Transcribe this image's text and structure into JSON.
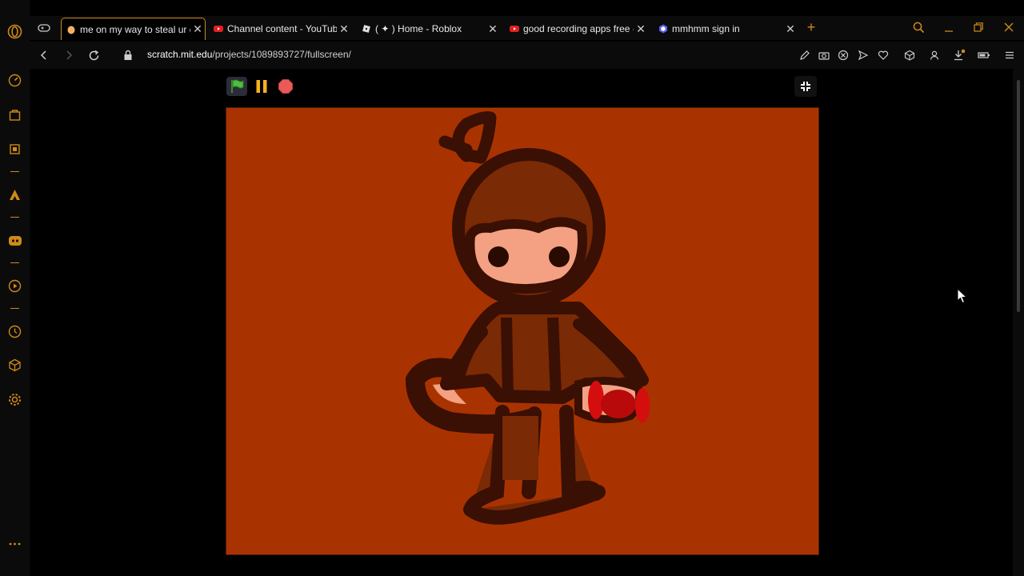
{
  "browser": {
    "tabs": [
      {
        "title": "me on my way to steal ur c",
        "active": true,
        "favicon": "scratch-cat-icon"
      },
      {
        "title": "Channel content - YouTube",
        "active": false,
        "favicon": "youtube-icon"
      },
      {
        "title": "( ✦ ) Home - Roblox",
        "active": false,
        "favicon": "roblox-icon"
      },
      {
        "title": "good recording apps free -",
        "active": false,
        "favicon": "youtube-icon"
      },
      {
        "title": "mmhmm sign in",
        "active": false,
        "favicon": "mmhmm-icon"
      }
    ],
    "new_tab_label": "+",
    "url_host": "scratch.mit.edu",
    "url_path": "/projects/1089893727/fullscreen/"
  },
  "sidebar": {
    "icons": [
      "opera-gx-logo-icon",
      "speedometer-icon",
      "bag-icon",
      "cpu-icon",
      "kick-icon",
      "discord-icon",
      "player-icon",
      "history-icon",
      "cube-icon",
      "gear-icon",
      "more-icon"
    ]
  },
  "toolbar_icons": [
    "edit-icon",
    "camera-icon",
    "block-icon",
    "send-icon",
    "heart-icon",
    "box-icon",
    "profile-icon",
    "download-icon",
    "battery-icon",
    "menu-icon"
  ],
  "scratch": {
    "controls": [
      "green-flag-icon",
      "pause-icon",
      "stop-icon"
    ],
    "exit_fullscreen_icon": "exit-fullscreen-icon"
  },
  "colors": {
    "accent": "#d08a16",
    "stage_bg": "#a93300",
    "outline": "#3a0f04",
    "skin": "#f3a182",
    "body_fill": "#7a2a05",
    "candy": "#d40e0e"
  }
}
